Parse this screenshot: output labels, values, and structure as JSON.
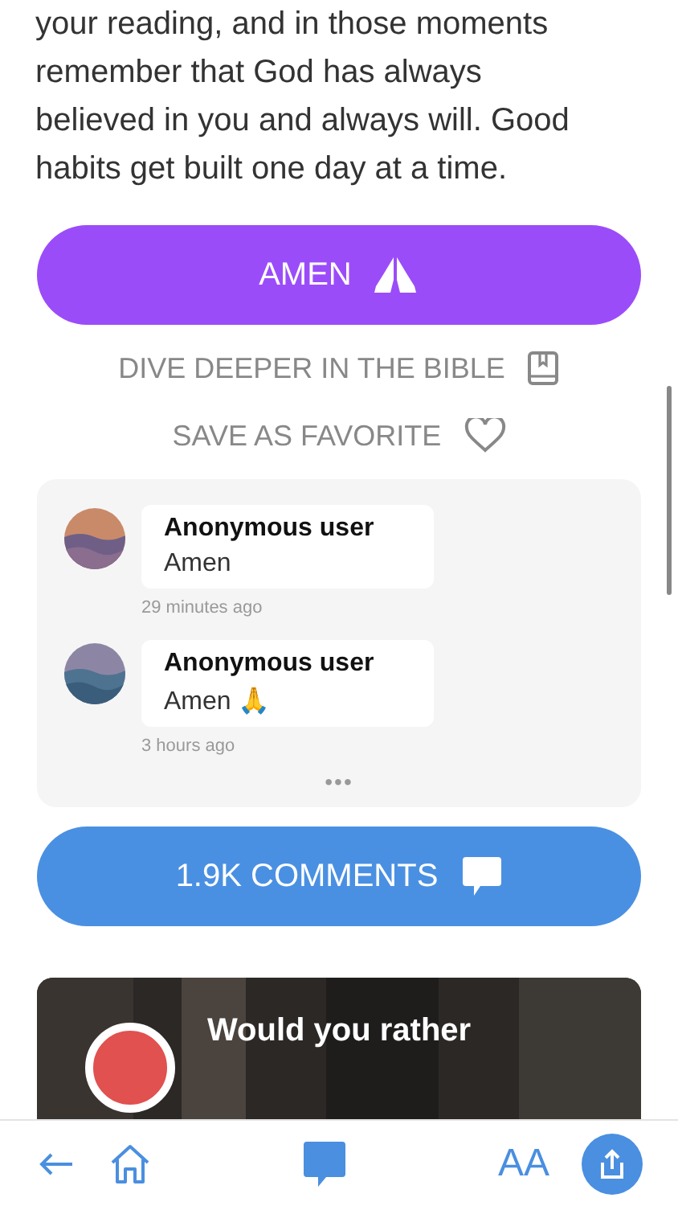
{
  "devotional": {
    "lines": [
      "your reading, and in those moments",
      "remember that God has always",
      "believed in you and always will. Good",
      "habits get built one day at a time."
    ]
  },
  "amen_button": {
    "label": "AMEN"
  },
  "links": [
    {
      "kind": "bible",
      "label": "DIVE DEEPER IN THE BIBLE"
    },
    {
      "kind": "favorite",
      "label": "SAVE AS FAVORITE",
      "selected": false
    }
  ],
  "comments": [
    {
      "author": "Anonymous user",
      "text": "Amen",
      "time": "29 minutes ago"
    },
    {
      "author": "Anonymous user",
      "text": "Amen 🙏",
      "time": "3 hours ago"
    }
  ],
  "more_label": "•••",
  "comments_button": {
    "label": "1.9K COMMENTS"
  },
  "card": {
    "title": "Would you rather"
  },
  "bottom_bar": {
    "font_label": "AA"
  }
}
